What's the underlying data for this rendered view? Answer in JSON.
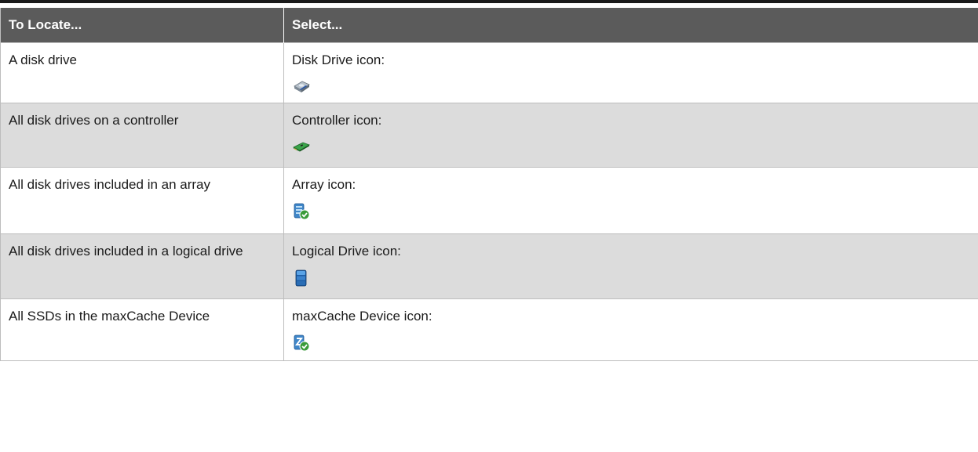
{
  "table": {
    "headers": {
      "locate": "To Locate...",
      "select": "Select..."
    },
    "rows": [
      {
        "locate": "A disk drive",
        "select": "Disk Drive icon:",
        "icon": "disk-drive-icon",
        "shaded": false
      },
      {
        "locate": "All disk drives on a controller",
        "select": "Controller icon:",
        "icon": "controller-icon",
        "shaded": true
      },
      {
        "locate": "All disk drives included in an array",
        "select": "Array icon:",
        "icon": "array-icon",
        "shaded": false
      },
      {
        "locate": "All disk drives included in a logical drive",
        "select": "Logical Drive icon:",
        "icon": "logical-drive-icon",
        "shaded": true
      },
      {
        "locate": "All SSDs in the maxCache Device",
        "select": "maxCache Device icon:",
        "icon": "maxcache-device-icon",
        "shaded": false
      }
    ]
  },
  "colors": {
    "header_bg": "#5b5b5b",
    "header_text": "#ffffff",
    "shaded_row": "#dcdcdc",
    "border": "#bdbdbd"
  }
}
